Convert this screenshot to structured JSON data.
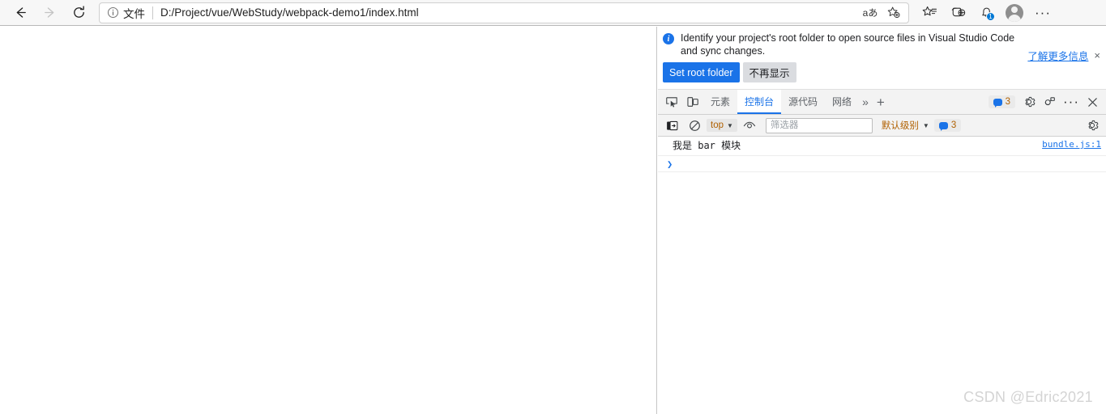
{
  "browser": {
    "back_label": "back-arrow",
    "forward_label": "forward-arrow",
    "reload_label": "reload",
    "omnibox": {
      "file_label": "文件",
      "url": "D:/Project/vue/WebStudy/webpack-demo1/index.html",
      "read_aloud_label": "aあ",
      "favorite_label": "add-favorite"
    },
    "toolbar_icons": {
      "collections": "collections",
      "browser_essentials": "browser-essentials",
      "notifications": "notifications",
      "notification_badge": "1",
      "profile": "profile",
      "settings_more": "···"
    }
  },
  "devtools": {
    "infobar": {
      "message": "Identify your project's root folder to open source files in Visual Studio Code and sync changes.",
      "link": "了解更多信息",
      "close": "×",
      "primary_button": "Set root folder",
      "secondary_button": "不再显示",
      "info_glyph": "i"
    },
    "tabbar": {
      "inspect_icon": "inspect-element",
      "device_icon": "device-toolbar",
      "tabs": [
        {
          "label": "元素",
          "active": false
        },
        {
          "label": "控制台",
          "active": true
        },
        {
          "label": "源代码",
          "active": false
        },
        {
          "label": "网络",
          "active": false
        }
      ],
      "more_tabs": "»",
      "add_tab": "+",
      "issues_count": "3",
      "settings_icon": "gear-icon",
      "customize_icon": "dock-icon",
      "more_icon": "···",
      "close_icon": "×"
    },
    "console_toolbar": {
      "sidebar_icon": "console-sidebar",
      "clear_icon": "clear-console",
      "context": "top",
      "eye_icon": "live-expression",
      "filter_placeholder": "筛选器",
      "filter_value": "",
      "level": "默认级别",
      "issues_count": "3",
      "settings_icon": "gear-icon"
    },
    "console": {
      "messages": [
        {
          "text": "我是 bar 模块",
          "source": "bundle.js:1"
        }
      ],
      "prompt_glyph": "❯",
      "prompt_value": ""
    }
  },
  "watermark": "CSDN @Edric2021",
  "colors": {
    "accent_blue": "#1a73e8",
    "toolbar_bg": "#f7f7f7",
    "devtools_bg": "#f3f3f3",
    "orange_text": "#b06000"
  }
}
